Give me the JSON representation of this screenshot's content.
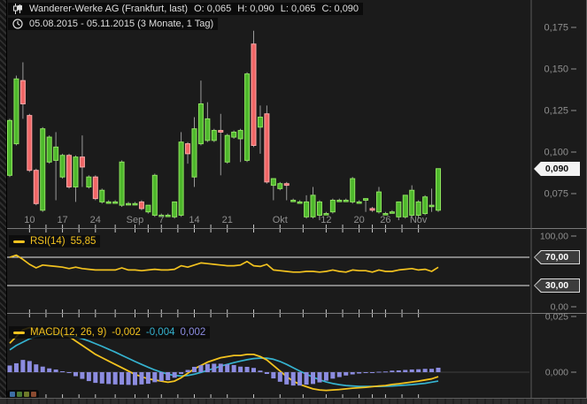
{
  "header": {
    "instrument": "Wanderer-Werke AG (Frankfurt, last)",
    "ohlc": {
      "o_label": "O:",
      "o": "0,065",
      "h_label": "H:",
      "h": "0,090",
      "l_label": "L:",
      "l": "0,065",
      "c_label": "C:",
      "c": "0,090"
    },
    "range": "05.08.2015 - 05.11.2015 (3 Monate, 1 Tag)"
  },
  "colors": {
    "background": "#1b1b1b",
    "candle_up": "#4eb82c",
    "candle_up_border": "#8fe45f",
    "candle_down": "#f06666",
    "candle_down_border": "#ffa8a8",
    "wick": "#9a9a9a",
    "rsi_line": "#f2c21f",
    "macd_line": "#f2c21f",
    "signal_line": "#35b2cf",
    "histogram": "#8c8ce0",
    "axis_text": "#8f8f8f",
    "tick": "#c8c8c8",
    "level_line": "#e8e8e8",
    "divider": "#787878",
    "axis_line": "#5a5a5a",
    "zero_line": "#3f3f3f"
  },
  "icons": {
    "instrument": "candlestick-icon",
    "period": "clock-icon",
    "rsi": "series-dash-icon",
    "macd": "series-dash-icon"
  },
  "toolbar": {
    "buttons": [
      {
        "name": "indicator-blue",
        "color": "#3d6ea5"
      },
      {
        "name": "indicator-green",
        "color": "#4c7a33"
      },
      {
        "name": "indicator-olive",
        "color": "#6e7a2a"
      },
      {
        "name": "indicator-red",
        "color": "#8a4a30"
      }
    ]
  },
  "chart_data": [
    {
      "type": "candlestick",
      "title": "Wanderer-Werke AG (Frankfurt, last)",
      "period": "05.08.2015 - 05.11.2015 (3 Monate, 1 Tag)",
      "ylim": [
        0.055,
        0.18
      ],
      "yticks": [
        {
          "v": 0.175,
          "label": "0,175"
        },
        {
          "v": 0.15,
          "label": "0,150"
        },
        {
          "v": 0.125,
          "label": "0,125"
        },
        {
          "v": 0.1,
          "label": "0,100"
        },
        {
          "v": 0.075,
          "label": "0,075"
        }
      ],
      "x_labels": [
        {
          "label": "10",
          "i": 3
        },
        {
          "label": "17",
          "i": 8
        },
        {
          "label": "24",
          "i": 13
        },
        {
          "label": "Sep",
          "i": 19
        },
        {
          "label": "7",
          "i": 23
        },
        {
          "label": "14",
          "i": 28
        },
        {
          "label": "21",
          "i": 33
        },
        {
          "label": "Okt",
          "i": 41
        },
        {
          "label": "12",
          "i": 48
        },
        {
          "label": "20",
          "i": 53
        },
        {
          "label": "26",
          "i": 57
        },
        {
          "label": "Nov",
          "i": 62
        }
      ],
      "last": {
        "value": 0.09,
        "label": "0,090"
      },
      "candles": [
        [
          0.086,
          0.12,
          0.085,
          0.119
        ],
        [
          0.105,
          0.146,
          0.104,
          0.144
        ],
        [
          0.143,
          0.154,
          0.12,
          0.129
        ],
        [
          0.122,
          0.123,
          0.088,
          0.089
        ],
        [
          0.089,
          0.09,
          0.068,
          0.069
        ],
        [
          0.065,
          0.115,
          0.064,
          0.114
        ],
        [
          0.094,
          0.11,
          0.093,
          0.109
        ],
        [
          0.095,
          0.112,
          0.071,
          0.103
        ],
        [
          0.085,
          0.099,
          0.084,
          0.098
        ],
        [
          0.098,
          0.099,
          0.078,
          0.079
        ],
        [
          0.079,
          0.098,
          0.07,
          0.097
        ],
        [
          0.097,
          0.11,
          0.079,
          0.091
        ],
        [
          0.079,
          0.086,
          0.078,
          0.085
        ],
        [
          0.085,
          0.086,
          0.071,
          0.072
        ],
        [
          0.07,
          0.078,
          0.069,
          0.077
        ],
        [
          0.07,
          0.071,
          0.069,
          0.07
        ],
        [
          0.07,
          0.071,
          0.069,
          0.07
        ],
        [
          0.068,
          0.095,
          0.067,
          0.094
        ],
        [
          0.069,
          0.07,
          0.068,
          0.069
        ],
        [
          0.069,
          0.07,
          0.068,
          0.069
        ],
        [
          0.07,
          0.071,
          0.065,
          0.066
        ],
        [
          0.064,
          0.068,
          0.063,
          0.068
        ],
        [
          0.062,
          0.087,
          0.061,
          0.086
        ],
        [
          0.062,
          0.063,
          0.061,
          0.062
        ],
        [
          0.062,
          0.063,
          0.061,
          0.062
        ],
        [
          0.061,
          0.07,
          0.06,
          0.07
        ],
        [
          0.062,
          0.112,
          0.061,
          0.106
        ],
        [
          0.105,
          0.106,
          0.093,
          0.099
        ],
        [
          0.085,
          0.121,
          0.079,
          0.114
        ],
        [
          0.105,
          0.143,
          0.104,
          0.129
        ],
        [
          0.107,
          0.13,
          0.106,
          0.12
        ],
        [
          0.107,
          0.114,
          0.106,
          0.113
        ],
        [
          0.113,
          0.123,
          0.086,
          0.112
        ],
        [
          0.094,
          0.111,
          0.093,
          0.11
        ],
        [
          0.109,
          0.113,
          0.108,
          0.112
        ],
        [
          0.108,
          0.114,
          0.094,
          0.113
        ],
        [
          0.095,
          0.148,
          0.094,
          0.147
        ],
        [
          0.165,
          0.173,
          0.103,
          0.104
        ],
        [
          0.115,
          0.128,
          0.099,
          0.121
        ],
        [
          0.123,
          0.128,
          0.081,
          0.082
        ],
        [
          0.08,
          0.084,
          0.071,
          0.084
        ],
        [
          0.078,
          0.082,
          0.077,
          0.081
        ],
        [
          0.081,
          0.082,
          0.071,
          0.08
        ],
        [
          0.071,
          0.072,
          0.07,
          0.071
        ],
        [
          0.07,
          0.071,
          0.069,
          0.07
        ],
        [
          0.061,
          0.074,
          0.06,
          0.07
        ],
        [
          0.061,
          0.079,
          0.06,
          0.074
        ],
        [
          0.062,
          0.071,
          0.059,
          0.07
        ],
        [
          0.063,
          0.064,
          0.062,
          0.063
        ],
        [
          0.064,
          0.072,
          0.063,
          0.071
        ],
        [
          0.071,
          0.072,
          0.07,
          0.071
        ],
        [
          0.071,
          0.072,
          0.07,
          0.071
        ],
        [
          0.07,
          0.085,
          0.069,
          0.084
        ],
        [
          0.07,
          0.071,
          0.069,
          0.07
        ],
        [
          0.071,
          0.072,
          0.064,
          0.072
        ],
        [
          0.066,
          0.067,
          0.064,
          0.065
        ],
        [
          0.064,
          0.079,
          0.063,
          0.076
        ],
        [
          0.063,
          0.064,
          0.062,
          0.063
        ],
        [
          0.064,
          0.065,
          0.063,
          0.064
        ],
        [
          0.061,
          0.07,
          0.059,
          0.07
        ],
        [
          0.061,
          0.074,
          0.06,
          0.074
        ],
        [
          0.062,
          0.08,
          0.061,
          0.077
        ],
        [
          0.062,
          0.071,
          0.06,
          0.07
        ],
        [
          0.063,
          0.074,
          0.062,
          0.073
        ],
        [
          0.068,
          0.078,
          0.064,
          0.068
        ],
        [
          0.065,
          0.09,
          0.064,
          0.09
        ]
      ]
    },
    {
      "type": "line",
      "name": "RSI(14)",
      "current": {
        "value": 55.85,
        "label": "55,85"
      },
      "ylim": [
        0,
        100
      ],
      "yticks": [
        {
          "v": 100,
          "label": "100,00"
        },
        {
          "v": 0,
          "label": "0,00"
        }
      ],
      "levels": [
        {
          "v": 70,
          "label": "70,00"
        },
        {
          "v": 30,
          "label": "30,00"
        }
      ],
      "values": [
        70,
        73,
        67,
        60,
        55,
        59,
        58,
        57,
        56,
        54,
        56,
        54,
        53,
        52,
        52,
        52,
        52,
        55,
        52,
        52,
        51,
        52,
        53,
        52,
        52,
        53,
        58,
        56,
        59,
        62,
        61,
        60,
        59,
        58,
        58,
        59,
        64,
        58,
        57,
        60,
        52,
        51,
        50,
        49,
        49,
        50,
        50,
        49,
        50,
        52,
        50,
        49,
        52,
        51,
        51,
        49,
        52,
        50,
        50,
        52,
        53,
        54,
        52,
        53,
        50,
        55.85
      ]
    },
    {
      "type": "macd",
      "name": "MACD(12, 26, 9)",
      "current": {
        "macd": -0.002,
        "macd_label": "-0,002",
        "signal": -0.004,
        "signal_label": "-0,004",
        "histogram": 0.002,
        "histogram_label": "0,002"
      },
      "ylim": [
        -0.012,
        0.026
      ],
      "yticks": [
        {
          "v": 0.025,
          "label": "0,025"
        },
        {
          "v": 0,
          "label": "0,000"
        }
      ],
      "macd": [
        0.013,
        0.016,
        0.019,
        0.02,
        0.0195,
        0.019,
        0.0185,
        0.018,
        0.017,
        0.016,
        0.014,
        0.012,
        0.01,
        0.008,
        0.0065,
        0.005,
        0.0035,
        0.002,
        0.0005,
        -0.001,
        -0.002,
        -0.003,
        -0.0035,
        -0.004,
        -0.0045,
        -0.004,
        -0.0025,
        -0.0005,
        0.0015,
        0.003,
        0.0045,
        0.0055,
        0.0065,
        0.007,
        0.0075,
        0.0075,
        0.008,
        0.008,
        0.007,
        0.0055,
        0.003,
        0.0005,
        -0.002,
        -0.004,
        -0.0055,
        -0.0065,
        -0.0075,
        -0.008,
        -0.0082,
        -0.008,
        -0.0078,
        -0.0075,
        -0.0072,
        -0.007,
        -0.0068,
        -0.0065,
        -0.0062,
        -0.006,
        -0.0055,
        -0.0052,
        -0.0048,
        -0.0044,
        -0.004,
        -0.0035,
        -0.003,
        -0.002
      ],
      "signal": [
        0.01,
        0.012,
        0.0135,
        0.015,
        0.016,
        0.0165,
        0.0168,
        0.0168,
        0.0166,
        0.0163,
        0.0158,
        0.015,
        0.014,
        0.0128,
        0.0116,
        0.0103,
        0.009,
        0.0076,
        0.0062,
        0.0048,
        0.0035,
        0.0022,
        0.001,
        0.0,
        -0.0009,
        -0.0015,
        -0.0017,
        -0.0015,
        -0.0009,
        -0.0001,
        0.0008,
        0.0017,
        0.0027,
        0.0035,
        0.0043,
        0.005,
        0.0056,
        0.0061,
        0.0063,
        0.0063,
        0.0058,
        0.0048,
        0.0035,
        0.002,
        0.0005,
        -0.0009,
        -0.0022,
        -0.0034,
        -0.0044,
        -0.0051,
        -0.0056,
        -0.006,
        -0.0062,
        -0.0064,
        -0.0064,
        -0.0064,
        -0.0064,
        -0.0063,
        -0.0062,
        -0.006,
        -0.0058,
        -0.0056,
        -0.0053,
        -0.005,
        -0.0045,
        -0.004
      ]
    }
  ]
}
